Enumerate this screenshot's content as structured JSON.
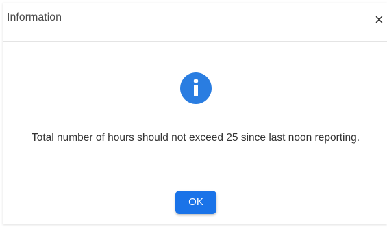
{
  "dialog": {
    "title": "Information",
    "close_symbol": "×",
    "icon": "info-icon",
    "icon_glyph": "i",
    "message": "Total number of hours should not exceed 25 since last noon reporting.",
    "ok_label": "OK"
  },
  "colors": {
    "accent": "#1a73e8",
    "icon_fill": "#2a7de1"
  }
}
